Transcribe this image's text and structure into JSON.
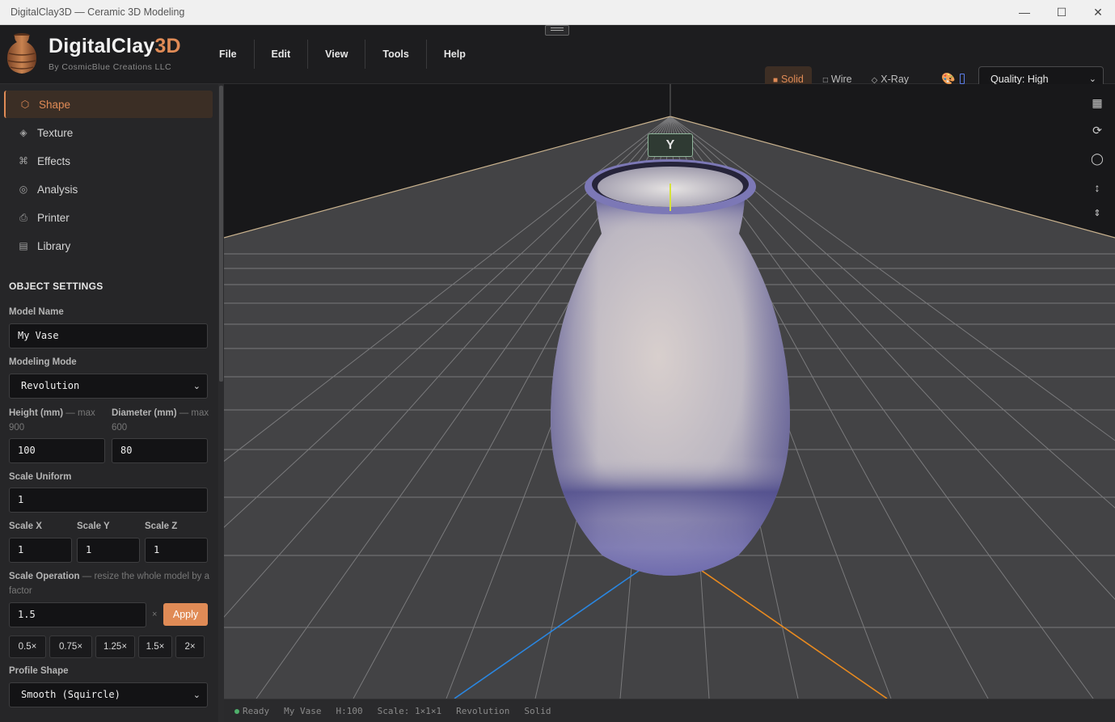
{
  "window": {
    "title": "DigitalClay3D — Ceramic 3D Modeling",
    "minimize_glyph": "—",
    "maximize_glyph": "☐",
    "close_glyph": "✕"
  },
  "brand": {
    "name_main": "DigitalClay",
    "name_accent": "3D",
    "subtitle": "By CosmicBlue Creations LLC",
    "logo_icon": "clay-pot-icon",
    "accent_color": "#e08b56"
  },
  "menu": [
    {
      "label": "File"
    },
    {
      "label": "Edit"
    },
    {
      "label": "View"
    },
    {
      "label": "Tools"
    },
    {
      "label": "Help"
    }
  ],
  "render_modes": [
    {
      "label": "Solid",
      "glyph": "■",
      "active": true
    },
    {
      "label": "Wire",
      "glyph": "□",
      "active": false
    },
    {
      "label": "X-Ray",
      "glyph": "◇",
      "active": false
    }
  ],
  "toolbar": {
    "palette_icon": "palette-icon",
    "quality_value": "Quality: High",
    "chevron_glyph": "⌄"
  },
  "nav": [
    {
      "label": "Shape",
      "glyph": "⬡",
      "icon": "hexagon-icon",
      "active": true
    },
    {
      "label": "Texture",
      "glyph": "◈",
      "icon": "diamond-icon",
      "active": false
    },
    {
      "label": "Effects",
      "glyph": "⌘",
      "icon": "command-icon",
      "active": false
    },
    {
      "label": "Analysis",
      "glyph": "◎",
      "icon": "target-icon",
      "active": false
    },
    {
      "label": "Printer",
      "glyph": "⎙",
      "icon": "printer-icon",
      "active": false
    },
    {
      "label": "Library",
      "glyph": "▤",
      "icon": "library-icon",
      "active": false
    }
  ],
  "settings": {
    "section_title": "OBJECT SETTINGS",
    "model_name_label": "Model Name",
    "model_name_value": "My Vase",
    "modeling_mode_label": "Modeling Mode",
    "modeling_mode_value": "Revolution",
    "height_label": "Height (mm)",
    "height_hint": "— max 900",
    "height_value": "100",
    "diameter_label": "Diameter (mm)",
    "diameter_hint": "— max 600",
    "diameter_value": "80",
    "scale_uniform_label": "Scale Uniform",
    "scale_uniform_value": "1",
    "scale_x_label": "Scale X",
    "scale_x_value": "1",
    "scale_y_label": "Scale Y",
    "scale_y_value": "1",
    "scale_z_label": "Scale Z",
    "scale_z_value": "1",
    "scale_op_label": "Scale Operation",
    "scale_op_hint": "— resize the whole model by a factor",
    "scale_op_value": "1.5",
    "times_glyph": "×",
    "apply_label": "Apply",
    "presets": [
      "0.5×",
      "0.75×",
      "1.25×",
      "1.5×",
      "2×"
    ],
    "profile_shape_label": "Profile Shape",
    "profile_shape_value": "Smooth (Squircle)"
  },
  "viewport": {
    "axis_label": "Y",
    "tools": [
      {
        "glyph": "▦",
        "icon": "grid-icon"
      },
      {
        "glyph": "⟳",
        "icon": "rotate-icon"
      },
      {
        "glyph": "◯",
        "icon": "sphere-icon"
      },
      {
        "glyph": "↕",
        "icon": "vertical-arrows-icon"
      },
      {
        "glyph": "⇕",
        "icon": "height-icon"
      }
    ]
  },
  "status": {
    "ready": "Ready",
    "model": "My Vase",
    "height": "H:100",
    "scale": "Scale: 1×1×1",
    "mode": "Revolution",
    "render": "Solid"
  }
}
